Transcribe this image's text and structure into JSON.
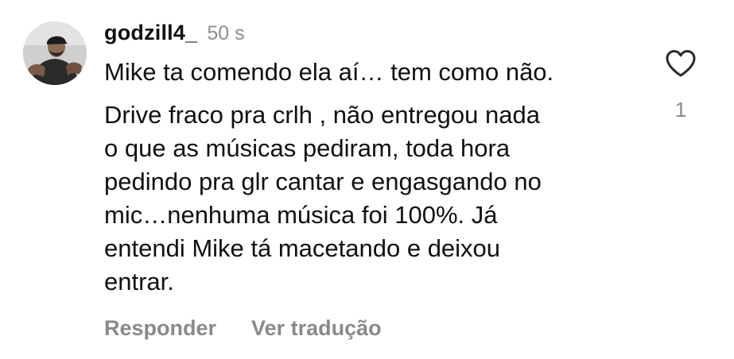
{
  "comment": {
    "username": "godzill4_",
    "time": "50 s",
    "paragraphs": [
      "Mike ta comendo ela aí… tem como não.",
      "Drive fraco pra crlh , não entregou nada\no que as músicas pediram, toda hora\npedindo pra glr cantar e engasgando no\nmic…nenhuma música foi 100%. Já\nentendi Mike tá macetando e deixou\nentrar."
    ],
    "actions": {
      "reply": "Responder",
      "translate": "Ver tradução"
    },
    "likes": "1"
  },
  "icons": {
    "like": "heart-outline-icon",
    "avatar": "profile-photo"
  },
  "colors": {
    "text": "#111111",
    "secondary": "#8e8e8e",
    "action": "#8a8a8a",
    "background": "#ffffff"
  }
}
